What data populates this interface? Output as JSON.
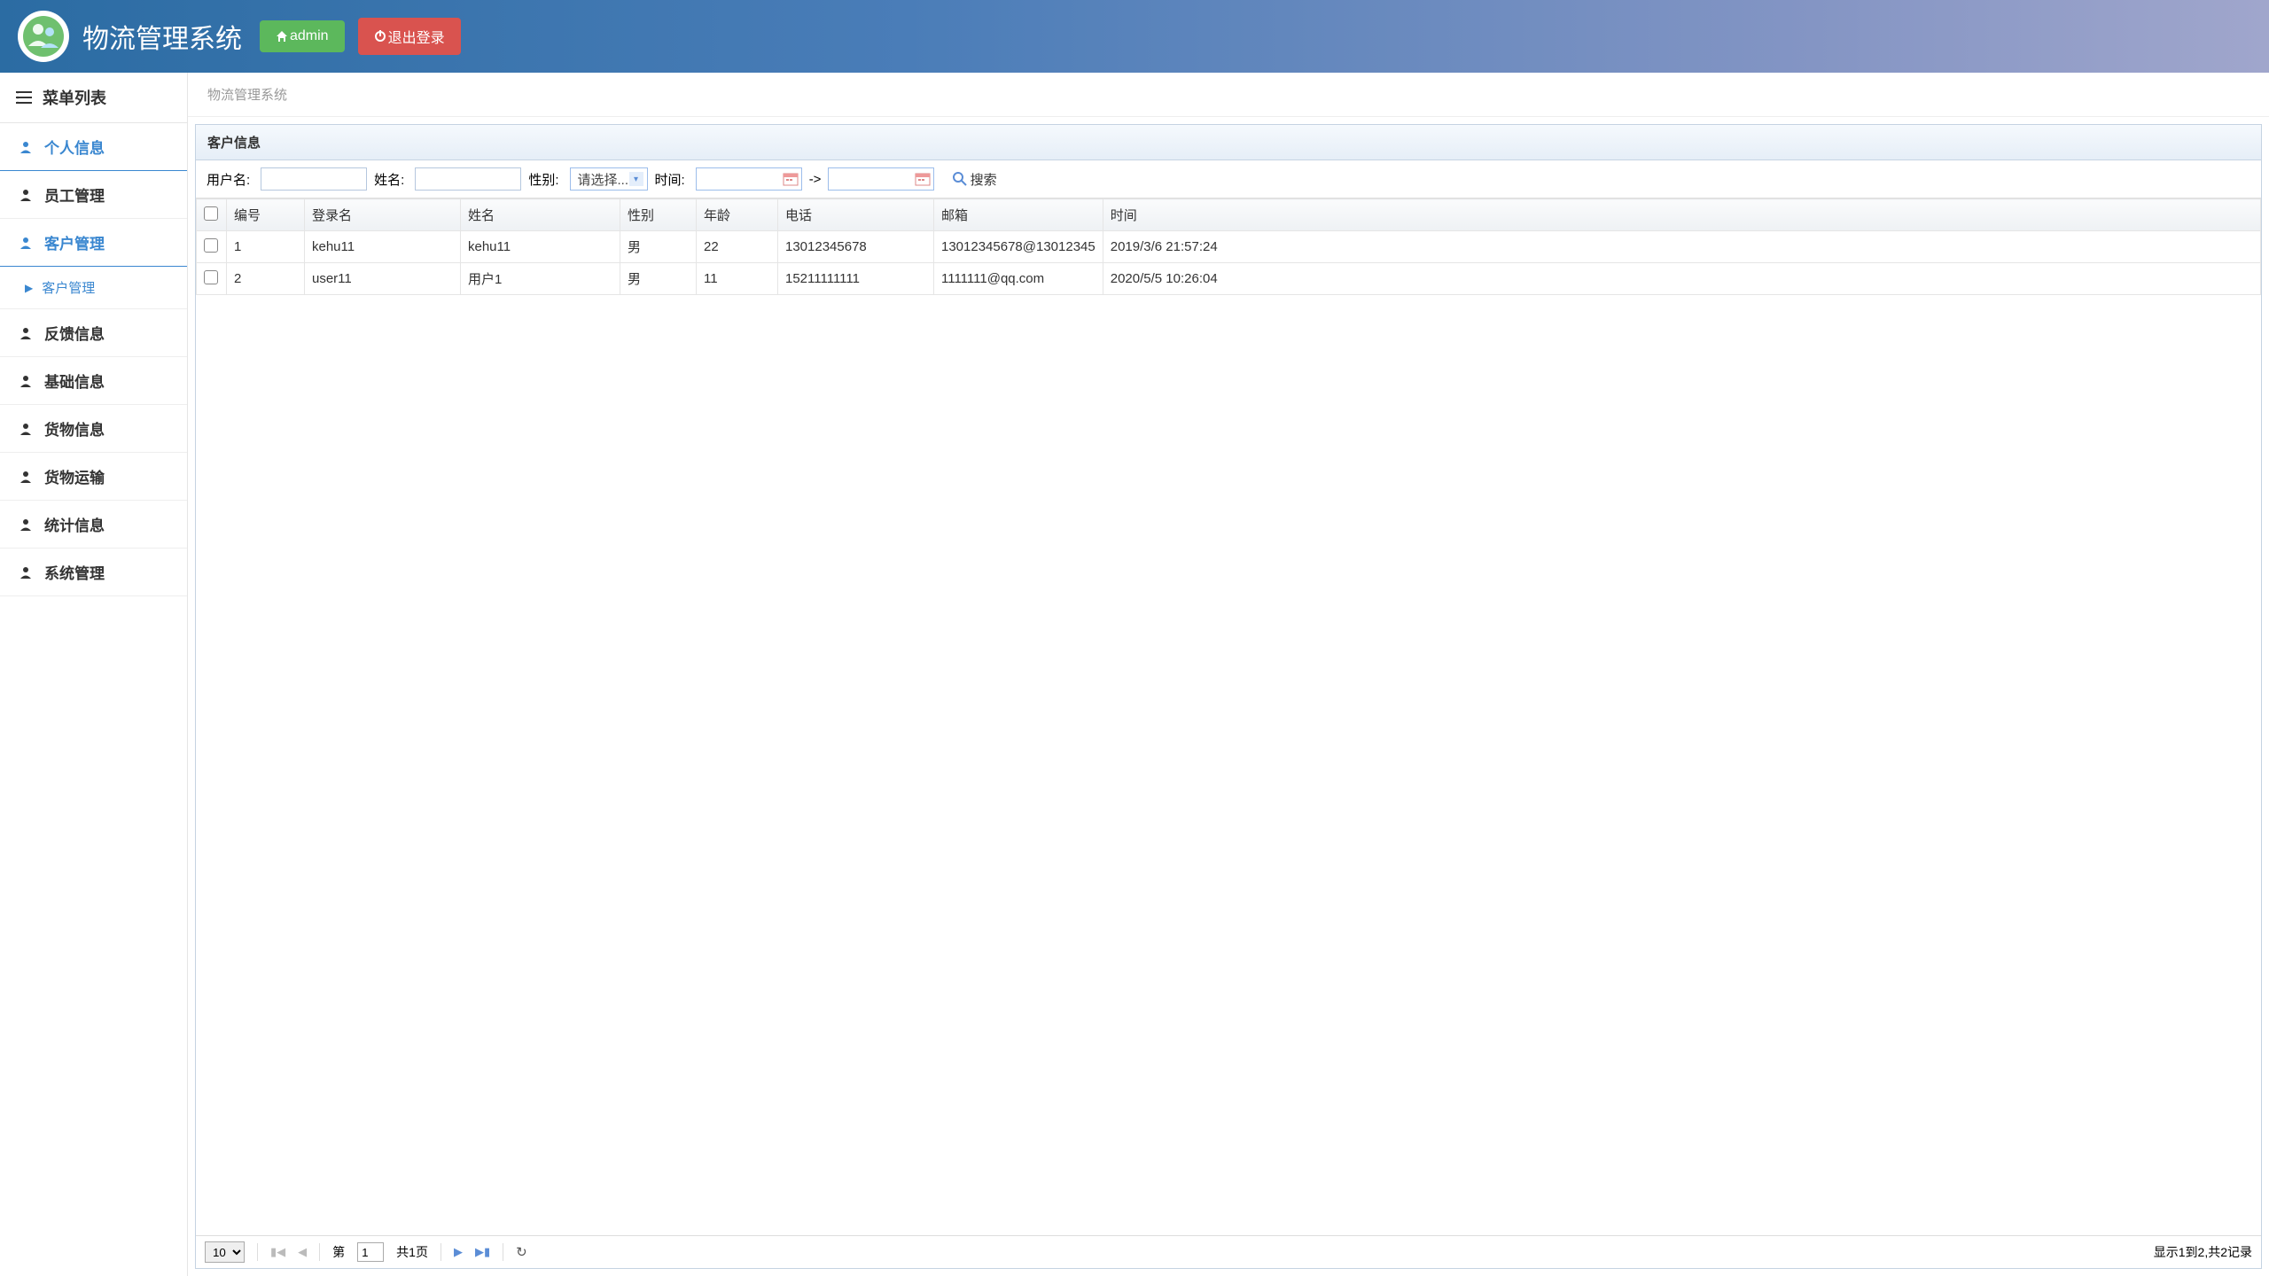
{
  "header": {
    "app_title": "物流管理系统",
    "admin_btn": "admin",
    "logout_btn": "退出登录"
  },
  "sidebar": {
    "header": "菜单列表",
    "items": [
      {
        "label": "个人信息",
        "active": true
      },
      {
        "label": "员工管理"
      },
      {
        "label": "客户管理",
        "active": true
      },
      {
        "label": "反馈信息"
      },
      {
        "label": "基础信息"
      },
      {
        "label": "货物信息"
      },
      {
        "label": "货物运输"
      },
      {
        "label": "统计信息"
      },
      {
        "label": "系统管理"
      }
    ],
    "sub_item": "客户管理"
  },
  "breadcrumb": "物流管理系统",
  "panel": {
    "title": "客户信息",
    "filter": {
      "username_label": "用户名:",
      "name_label": "姓名:",
      "gender_label": "性别:",
      "gender_placeholder": "请选择...",
      "time_label": "时间:",
      "range_sep": "->",
      "search_btn": "搜索"
    },
    "columns": [
      "编号",
      "登录名",
      "姓名",
      "性别",
      "年龄",
      "电话",
      "邮箱",
      "时间"
    ],
    "rows": [
      {
        "id": "1",
        "login": "kehu11",
        "name": "kehu11",
        "gender": "男",
        "age": "22",
        "phone": "13012345678",
        "email": "13012345678@13012345",
        "time": "2019/3/6 21:57:24"
      },
      {
        "id": "2",
        "login": "user11",
        "name": "用户1",
        "gender": "男",
        "age": "11",
        "phone": "15211111111",
        "email": "1111111@qq.com",
        "time": "2020/5/5 10:26:04"
      }
    ],
    "pager": {
      "page_size": "10",
      "page_label_pre": "第",
      "page_current": "1",
      "page_total_label": "共1页",
      "info": "显示1到2,共2记录"
    }
  }
}
